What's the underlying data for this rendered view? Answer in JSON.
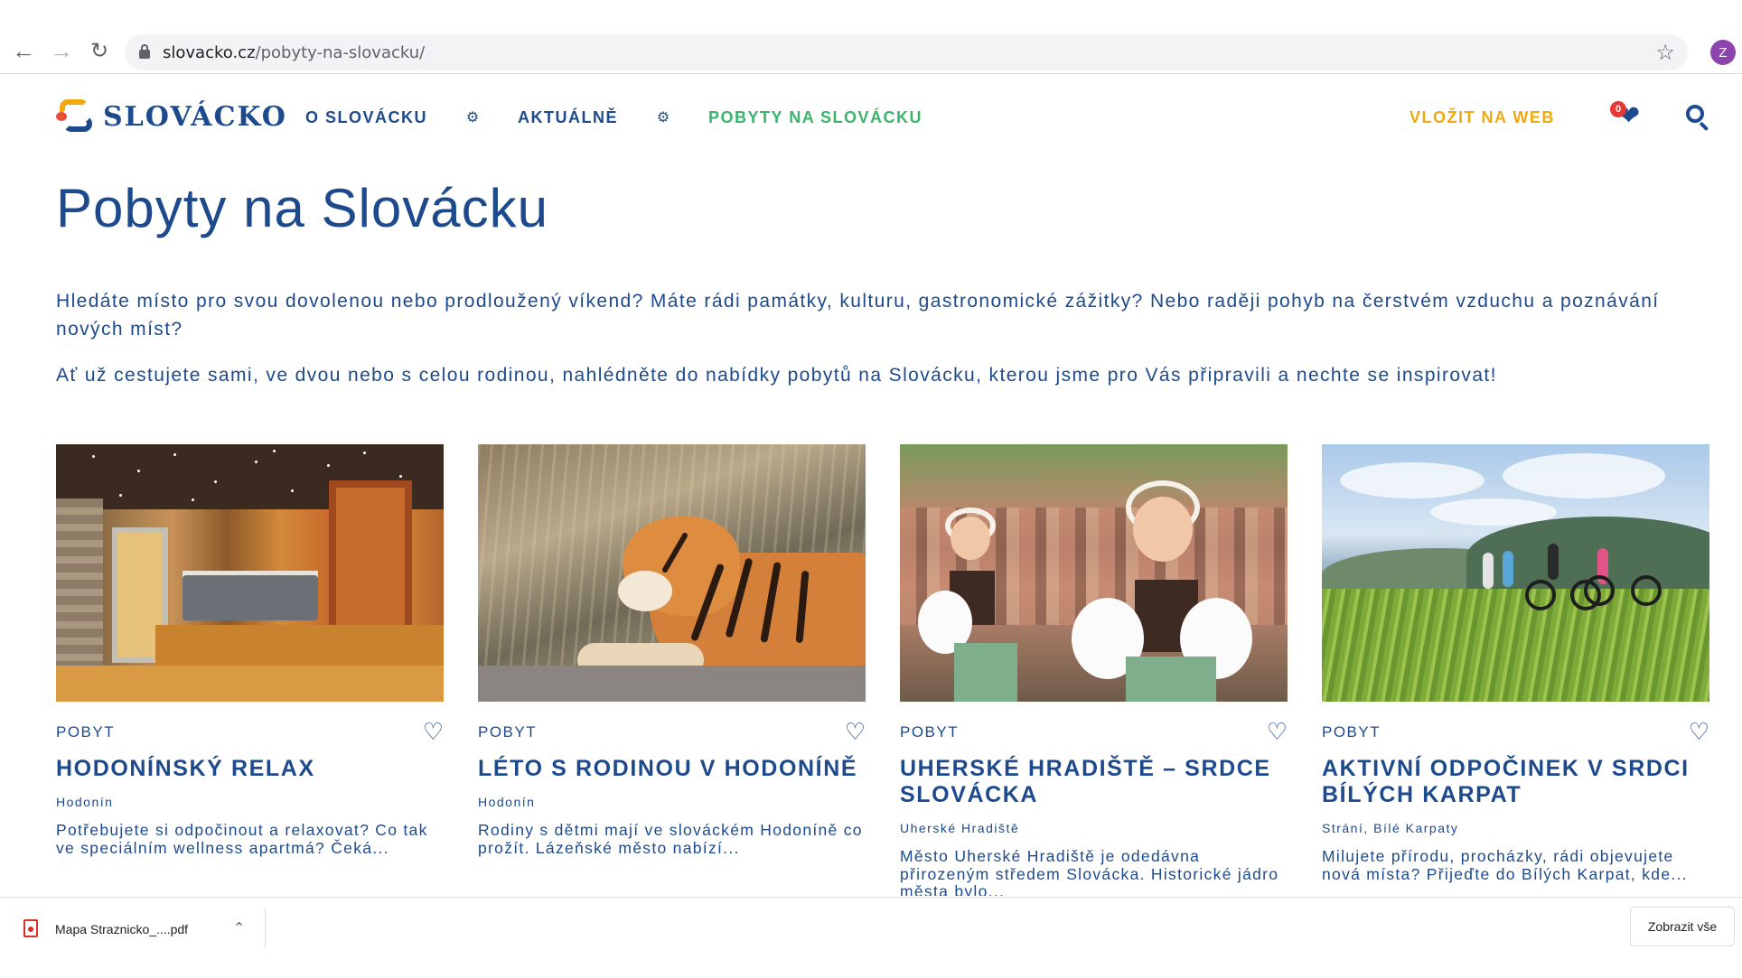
{
  "browser": {
    "url_host": "slovacko.cz",
    "url_path": "/pobyty-na-slovacku/",
    "profile_initial": "Z",
    "back_icon": "arrow-left-icon",
    "forward_icon": "arrow-right-icon",
    "reload_icon": "reload-icon",
    "bookmark_icon": "star-outline-icon"
  },
  "header": {
    "logo_text": "SLOVÁCKO",
    "nav": [
      {
        "label": "O SLOVÁCKU",
        "active": false
      },
      {
        "label": "AKTUÁLNĚ",
        "active": false
      },
      {
        "label": "POBYTY NA SLOVÁCKU",
        "active": true
      }
    ],
    "cta_label": "VLOŽIT NA WEB",
    "favorites_count": "0",
    "colors": {
      "brand": "#1d4a8c",
      "active": "#3bb36b",
      "cta": "#f2a90f",
      "badge": "#e53935"
    }
  },
  "main": {
    "title": "Pobyty na Slovácku",
    "intro_1": "Hledáte místo pro svou dovolenou nebo prodloužený víkend? Máte rádi památky, kulturu, gastronomické zážitky? Nebo raději pohyb na čerstvém vzduchu a poznávání nových míst?",
    "intro_2": "Ať už cestujete sami, ve dvou nebo s celou rodinou, nahlédněte do nabídky pobytů na Slovácku, kterou jsme pro Vás připravili a nechte se inspirovat!",
    "cards": [
      {
        "type": "POBYT",
        "title": "HODONÍNSKÝ RELAX",
        "location": "Hodonín",
        "description": "Potřebujete si odpočinout a relaxovat? Co tak ve speciálním wellness apartmá? Čeká..."
      },
      {
        "type": "POBYT",
        "title": "LÉTO S RODINOU V HODONÍNĚ",
        "location": "Hodonín",
        "description": "Rodiny s dětmi mají ve slováckém Hodoníně co prožít. Lázeňské město nabízí..."
      },
      {
        "type": "POBYT",
        "title": "UHERSKÉ HRADIŠTĚ – SRDCE SLOVÁCKA",
        "location": "Uherské Hradiště",
        "description": "Město Uherské Hradiště je odedávna přirozeným středem Slovácka. Historické jádro města bylo..."
      },
      {
        "type": "POBYT",
        "title": "AKTIVNÍ ODPOČINEK V SRDCI BÍLÝCH KARPAT",
        "location": "Strání, Bílé Karpaty",
        "description": "Milujete přírodu, procházky, rádi objevujete nová místa? Přijeďte do Bílých Karpat, kde..."
      }
    ]
  },
  "downloads": {
    "file_name": "Mapa Straznicko_....pdf",
    "show_all_label": "Zobrazit vše"
  }
}
